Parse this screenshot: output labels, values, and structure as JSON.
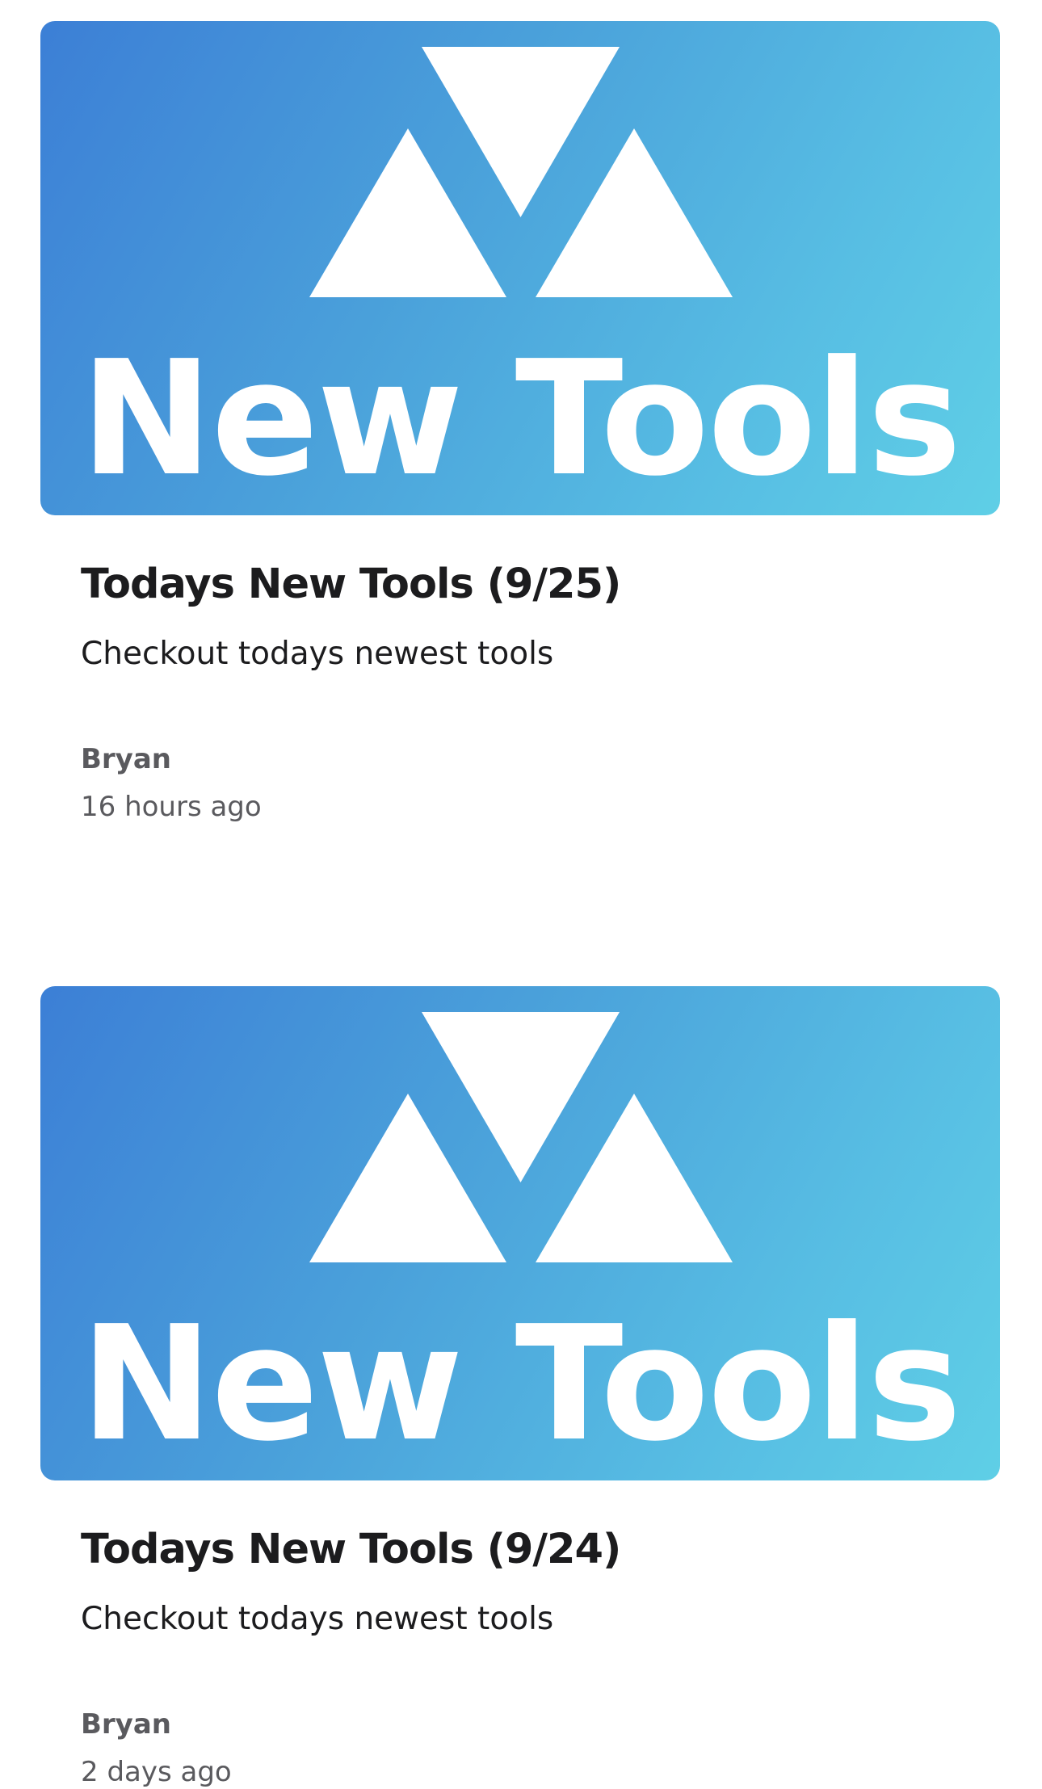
{
  "posts": [
    {
      "banner_text": "New Tools",
      "title": "Todays New Tools (9/25)",
      "description": "Checkout todays newest tools",
      "author": "Bryan",
      "time": "16 hours ago"
    },
    {
      "banner_text": "New Tools",
      "title": "Todays New Tools (9/24)",
      "description": "Checkout todays newest tools",
      "author": "Bryan",
      "time": "2 days ago"
    }
  ],
  "colors": {
    "banner_gradient_start": "#3c7fd6",
    "banner_gradient_end": "#5fcfe6",
    "title_text": "#1c1c1e",
    "meta_text": "#5a5a5e"
  },
  "icons": {
    "banner_logo": "three-triangles-logo-icon"
  }
}
